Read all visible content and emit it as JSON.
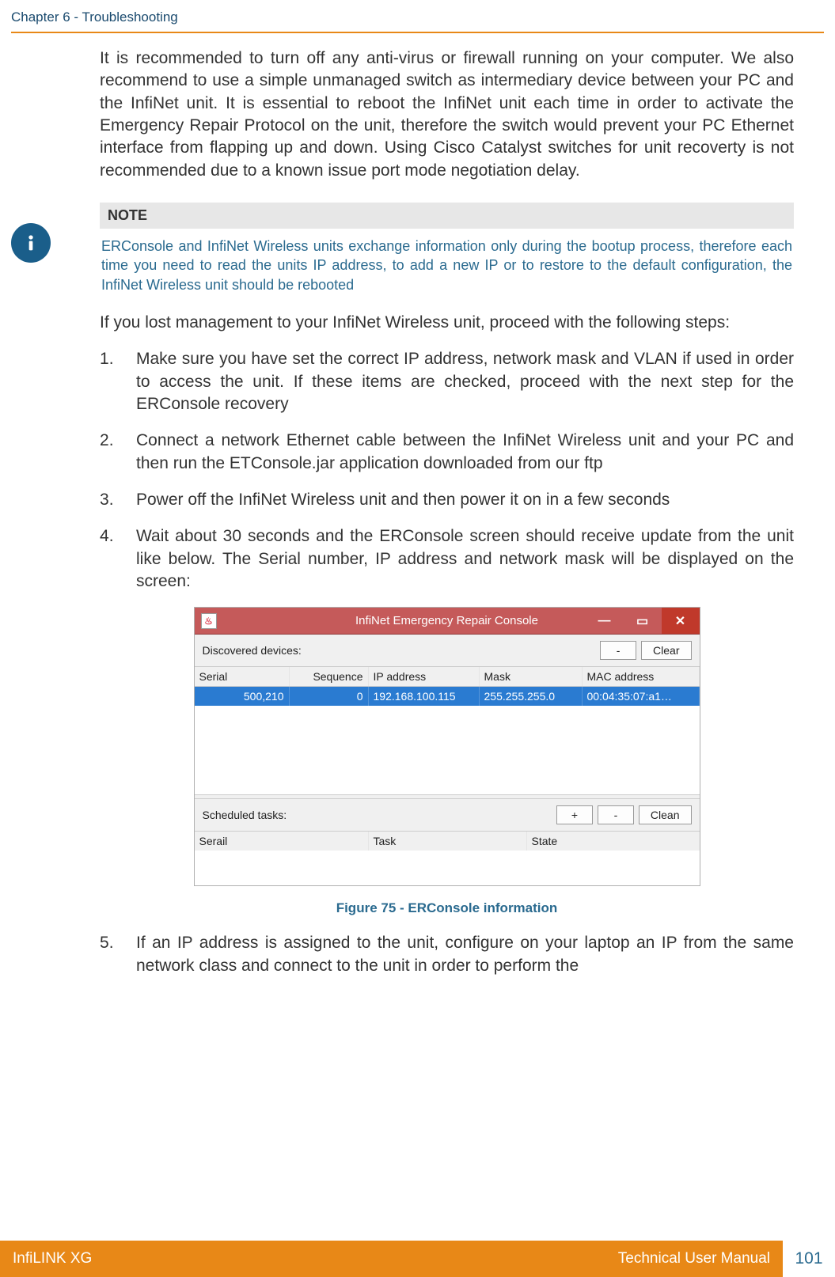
{
  "header": {
    "chapter": "Chapter 6 - Troubleshooting"
  },
  "intro_para": "It is recommended to turn off any anti-virus or firewall running on your computer. We also recommend to use a simple unmanaged switch as intermediary device between your PC and the InfiNet unit. It is essential to reboot the InfiNet unit each time in order to activate the Emergency Repair Protocol on the unit, therefore the switch would prevent your PC Ethernet interface from flapping up and down. Using Cisco Catalyst switches for unit recoverty is not recommended due to a known issue port mode negotiation delay.",
  "note": {
    "heading": "NOTE",
    "body": "ERConsole and InfiNet Wireless units exchange information only during the bootup process, therefore each time you need to read the units IP address, to add a new IP or to restore to the default configuration, the InfiNet Wireless unit should be rebooted"
  },
  "steps_intro": "If you lost management to your InfiNet Wireless unit, proceed with the following steps:",
  "steps": [
    "Make sure you have set the correct IP address, network mask and VLAN if used in order to access the unit. If these items are checked, proceed with the next step for the ERConsole recovery",
    "Connect a network Ethernet cable between the InfiNet Wireless unit and your PC and then run the ETConsole.jar application downloaded from our ftp",
    "Power off the InfiNet Wireless unit and then power it on in a few seconds",
    "Wait about 30 seconds and the ERConsole screen should receive update from the unit like below. The Serial number, IP address and network mask will be displayed on the screen:",
    "If an IP address is assigned to the unit, configure on your laptop an IP from the same network class and connect to the unit in order to perform the"
  ],
  "console": {
    "title": "InfiNet Emergency Repair Console",
    "discovered_label": "Discovered devices:",
    "minus": "-",
    "clear": "Clear",
    "headers": {
      "serial": "Serial",
      "sequence": "Sequence",
      "ip": "IP address",
      "mask": "Mask",
      "mac": "MAC address"
    },
    "row": {
      "serial": "500,210",
      "sequence": "0",
      "ip": "192.168.100.115",
      "mask": "255.255.255.0",
      "mac": "00:04:35:07:a1…"
    },
    "scheduled_label": "Scheduled tasks:",
    "plus": "+",
    "minus2": "-",
    "clean": "Clean",
    "headers2": {
      "serail": "Serail",
      "task": "Task",
      "state": "State"
    }
  },
  "figure_caption": "Figure 75 - ERConsole information",
  "footer": {
    "left": "InfiLINK XG",
    "right": "Technical User Manual",
    "page": "101"
  }
}
